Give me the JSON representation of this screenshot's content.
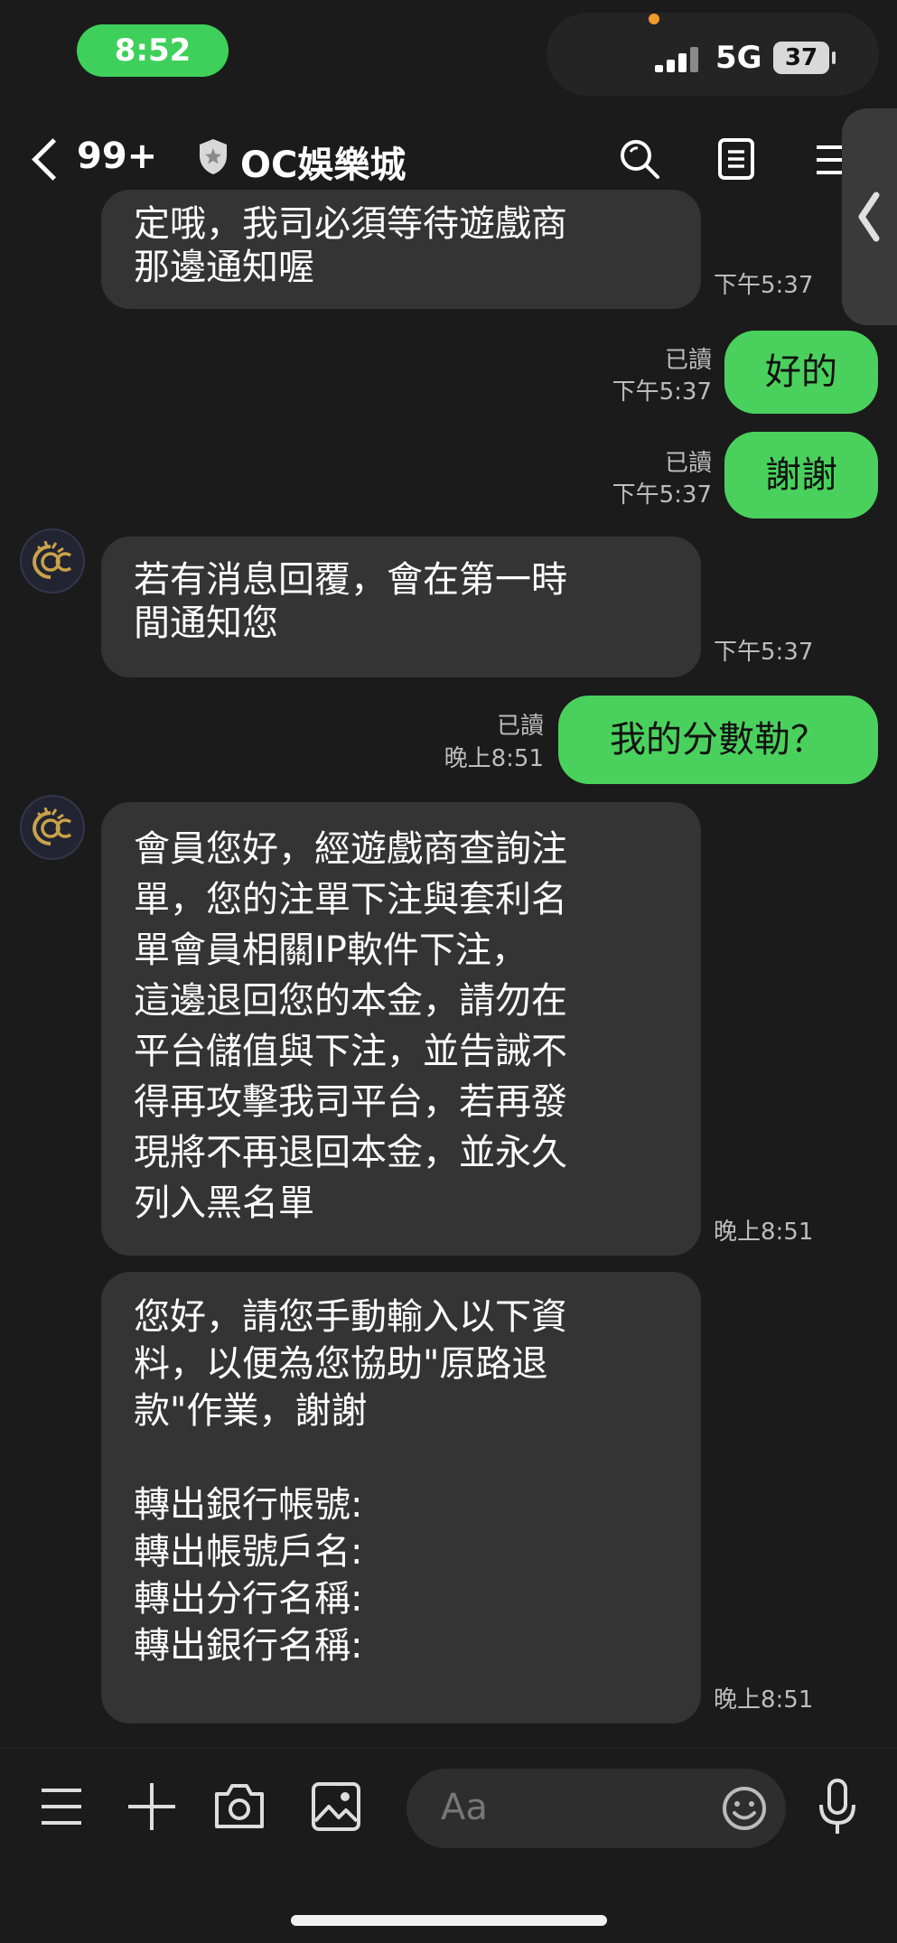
{
  "status_bar": {
    "time": "8:52",
    "network": "5G",
    "battery": "37"
  },
  "header": {
    "unread_count": "99+",
    "title": "OC娛樂城"
  },
  "messages": [
    {
      "text": "定哦，我司必須等待遊戲商\n那邊通知喔",
      "time": "下午5:37"
    },
    {
      "text": "好的",
      "read": "已讀",
      "time": "下午5:37"
    },
    {
      "text": "謝謝",
      "read": "已讀",
      "time": "下午5:37"
    },
    {
      "text": "若有消息回覆，會在第一時\n間通知您",
      "time": "下午5:37"
    },
    {
      "text": "我的分數勒？",
      "read": "已讀",
      "time": "晚上8:51"
    },
    {
      "text": "會員您好，經遊戲商查詢注\n單，您的注單下注與套利名\n單會員相關IP軟件下注，\n這邊退回您的本金，請勿在\n平台儲值與下注，並告誡不\n得再攻擊我司平台，若再發\n現將不再退回本金，並永久\n列入黑名單",
      "time": "晚上8:51"
    },
    {
      "text": "您好，請您手動輸入以下資\n料，以便為您協助\"原路退\n款\"作業，謝謝\n\n轉出銀行帳號:\n轉出帳號戶名:\n轉出分行名稱:\n轉出銀行名稱:",
      "time": "晚上8:51"
    }
  ],
  "composer": {
    "placeholder": "Aa"
  },
  "colors": {
    "accent_green": "#4ad15d",
    "bubble_incoming": "#343434",
    "background": "#1b1b1b"
  }
}
